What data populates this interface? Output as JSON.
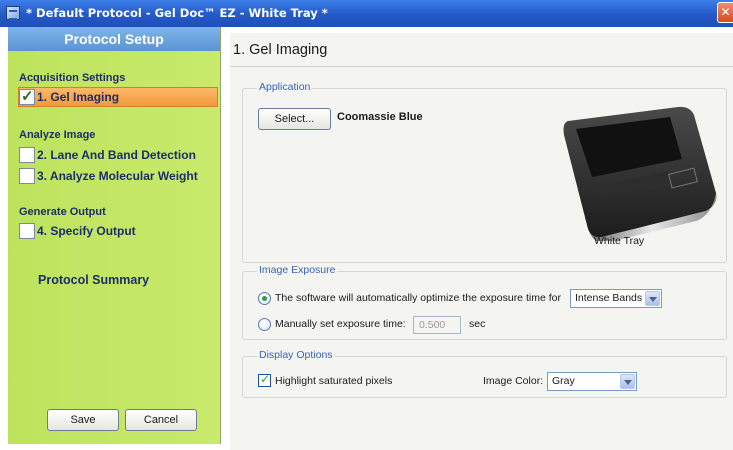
{
  "window": {
    "title": "* Default Protocol - Gel Doc™ EZ - White Tray *",
    "close_icon": "close-icon",
    "close_glyph": "✕"
  },
  "sidebar": {
    "header": "Protocol Setup",
    "sections": [
      {
        "label": "Acquisition Settings",
        "steps": [
          {
            "label": "1. Gel Imaging",
            "active": true,
            "checked": true
          }
        ]
      },
      {
        "label": "Analyze Image",
        "steps": [
          {
            "label": "2. Lane And Band Detection",
            "active": false,
            "checked": false
          },
          {
            "label": "3. Analyze Molecular Weight",
            "active": false,
            "checked": false
          }
        ]
      },
      {
        "label": "Generate Output",
        "steps": [
          {
            "label": "4. Specify Output",
            "active": false,
            "checked": false
          }
        ]
      }
    ],
    "summary": "Protocol Summary",
    "save_label": "Save",
    "cancel_label": "Cancel",
    "check_glyph": "✓",
    "colors": {
      "panel": "#c3e765",
      "active_step": "#f7a84e",
      "header": "#6ea6de"
    }
  },
  "main": {
    "page_title": "1. Gel Imaging",
    "application": {
      "legend": "Application",
      "select_label": "Select...",
      "stain": "Coomassie Blue",
      "tray_label": "White Tray"
    },
    "exposure": {
      "legend": "Image Exposure",
      "auto_label": "The software will automatically optimize the exposure time for",
      "auto_selected": true,
      "auto_option": "Intense Bands",
      "manual_label": "Manually set exposure time:",
      "manual_value": "0.500",
      "manual_unit": "sec"
    },
    "display": {
      "legend": "Display Options",
      "highlight_label": "Highlight saturated pixels",
      "highlight_checked": true,
      "color_label": "Image Color:",
      "color_value": "Gray",
      "check_glyph": "✓"
    }
  }
}
